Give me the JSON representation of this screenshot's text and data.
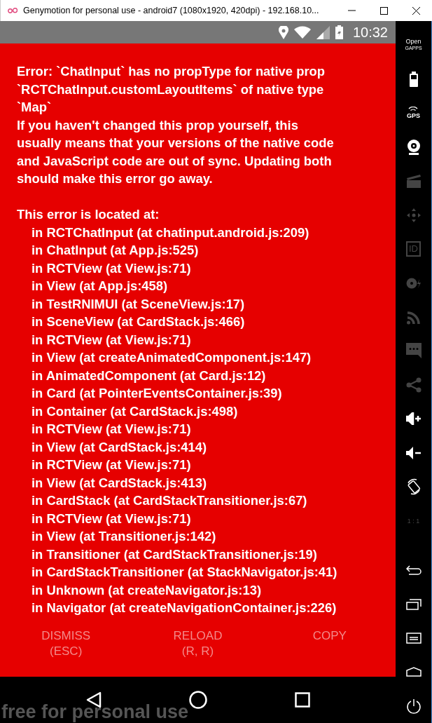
{
  "window": {
    "title": "Genymotion for personal use - android7 (1080x1920, 420dpi) - 192.168.10..."
  },
  "status_bar": {
    "time": "10:32"
  },
  "error": {
    "paragraphs": [
      "Error: `ChatInput` has no propType for native prop\n`RCTChatInput.customLayoutItems` of native type\n`Map`",
      "If you haven't changed this prop yourself, this\nusually means that your versions of the native code\nand JavaScript code are out of sync. Updating both\nshould make this error go away."
    ],
    "stack_title": "This error is located at:",
    "stack": [
      "in RCTChatInput (at chatinput.android.js:209)",
      "in ChatInput (at App.js:525)",
      "in RCTView (at View.js:71)",
      "in View (at App.js:458)",
      "in TestRNIMUI (at SceneView.js:17)",
      "in SceneView (at CardStack.js:466)",
      "in RCTView (at View.js:71)",
      "in View (at createAnimatedComponent.js:147)",
      "in AnimatedComponent (at Card.js:12)",
      "in Card (at PointerEventsContainer.js:39)",
      "in Container (at CardStack.js:498)",
      "in RCTView (at View.js:71)",
      "in View (at CardStack.js:414)",
      "in RCTView (at View.js:71)",
      "in View (at CardStack.js:413)",
      "in CardStack (at CardStackTransitioner.js:67)",
      "in RCTView (at View.js:71)",
      "in View (at Transitioner.js:142)",
      "in Transitioner (at CardStackTransitioner.js:19)",
      "in CardStackTransitioner (at StackNavigator.js:41)",
      "in Unknown (at createNavigator.js:13)",
      "in Navigator (at createNavigationContainer.js:226)"
    ],
    "buttons": [
      "DISMISS\n(ESC)",
      "RELOAD\n(R, R)",
      "COPY"
    ]
  },
  "watermark": "free for personal use",
  "sidebar": {
    "items": [
      {
        "kind": "gapps",
        "label": "Open",
        "sublabel": "GAPPS",
        "disabled": false
      },
      {
        "kind": "battery",
        "disabled": false
      },
      {
        "kind": "gps",
        "label": "GPS",
        "disabled": false
      },
      {
        "kind": "webcam",
        "disabled": false
      },
      {
        "kind": "clapperboard",
        "disabled": true
      },
      {
        "kind": "dpad",
        "disabled": true
      },
      {
        "kind": "id",
        "label": "ID",
        "disabled": true
      },
      {
        "kind": "disk",
        "disabled": true
      },
      {
        "kind": "rss",
        "disabled": true
      },
      {
        "kind": "chat",
        "disabled": true
      },
      {
        "kind": "share",
        "disabled": true
      },
      {
        "kind": "volume-up",
        "disabled": false
      },
      {
        "kind": "volume-down",
        "disabled": false
      },
      {
        "kind": "rotate",
        "disabled": false
      },
      {
        "kind": "ratio",
        "label": "1 : 1",
        "disabled": true
      },
      {
        "kind": "back",
        "disabled": false
      },
      {
        "kind": "recent",
        "disabled": false
      },
      {
        "kind": "menu",
        "disabled": false
      },
      {
        "kind": "home",
        "disabled": false
      },
      {
        "kind": "power",
        "disabled": false
      }
    ]
  }
}
